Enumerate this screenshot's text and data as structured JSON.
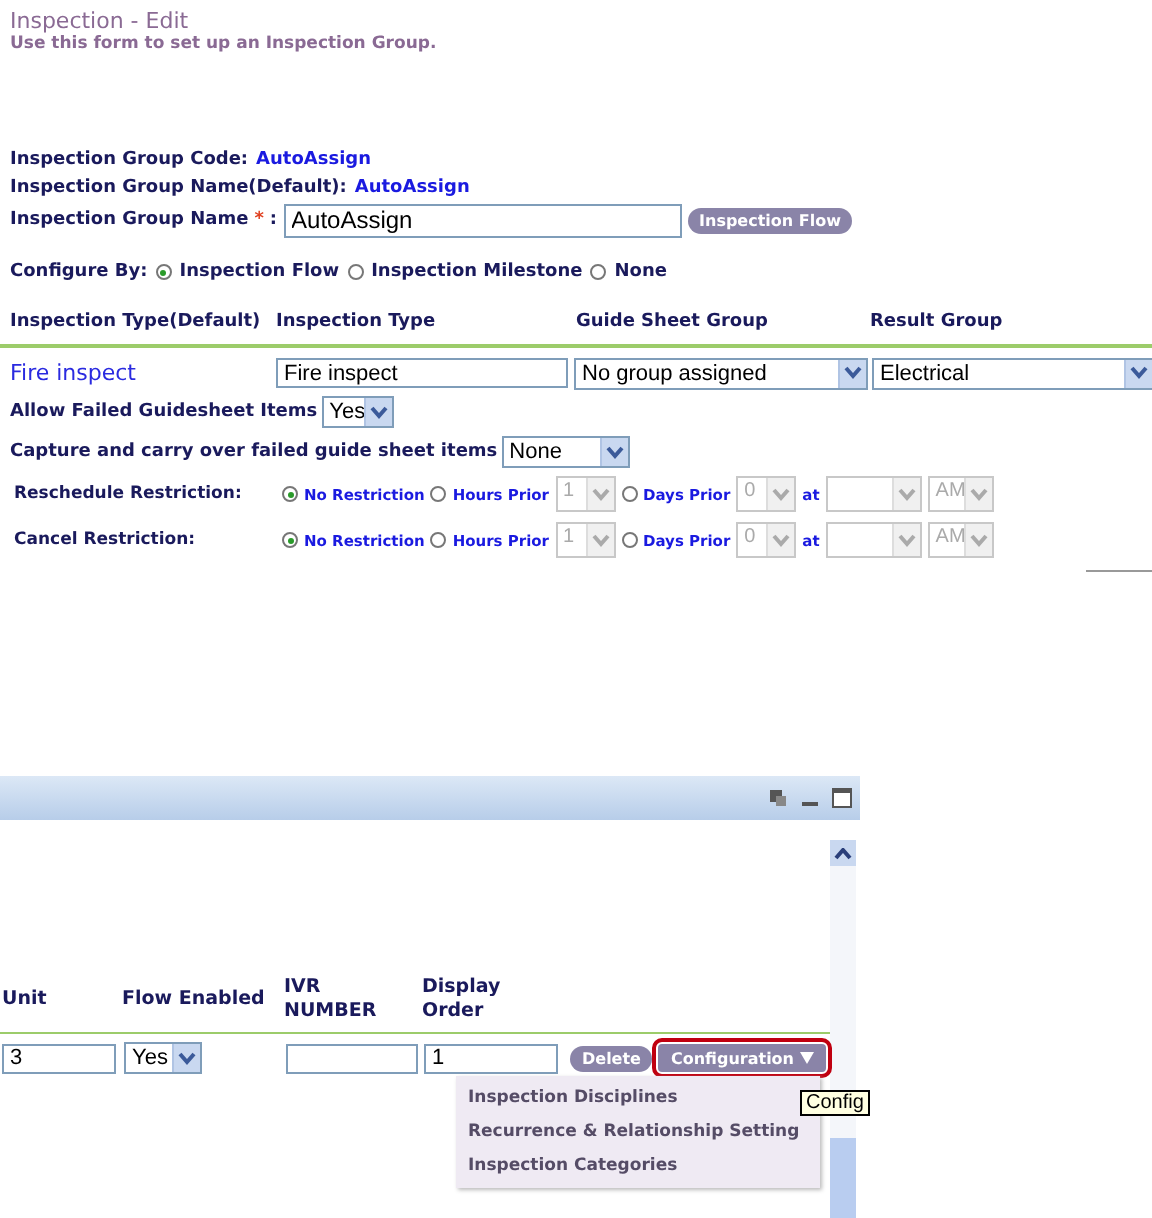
{
  "page": {
    "title": "Inspection - Edit",
    "subtitle": "Use this form to set up an Inspection Group."
  },
  "fields": [
    {
      "label": "Inspection Group Code:",
      "value": "AutoAssign"
    },
    {
      "label": "Inspection Group Name(Default):",
      "value": "AutoAssign"
    }
  ],
  "group_name": {
    "label": "Inspection Group Name",
    "required_mark": "*",
    "colon": ":",
    "value": "AutoAssign",
    "button": "Inspection Flow"
  },
  "configure_by": {
    "label": "Configure By:",
    "options": [
      {
        "label": "Inspection Flow",
        "selected": true
      },
      {
        "label": "Inspection Milestone",
        "selected": false
      },
      {
        "label": "None",
        "selected": false
      }
    ]
  },
  "type_table": {
    "columns": [
      "Inspection Type(Default)",
      "Inspection Type",
      "Guide Sheet Group",
      "Result Group"
    ],
    "row": {
      "default_type": "Fire inspect",
      "inspection_type": "Fire inspect",
      "guide_sheet_group": "No group assigned",
      "result_group": "Electrical"
    }
  },
  "allow_failed": {
    "label": "Allow Failed Guidesheet Items",
    "value": "Yes"
  },
  "capture": {
    "label": "Capture and carry over failed guide sheet items",
    "value": "None"
  },
  "restrictions": [
    {
      "label": "Reschedule Restriction:",
      "options": [
        {
          "label": "No Restriction",
          "selected": true
        },
        {
          "label": "Hours Prior",
          "selected": false
        },
        {
          "label": "Days Prior",
          "selected": false
        }
      ],
      "hours": "1",
      "days": "0",
      "at": "at",
      "ampm": "AM",
      "disabled": true
    },
    {
      "label": "Cancel Restriction:",
      "options": [
        {
          "label": "No Restriction",
          "selected": true
        },
        {
          "label": "Hours Prior",
          "selected": false
        },
        {
          "label": "Days Prior",
          "selected": false
        }
      ],
      "hours": "1",
      "days": "0",
      "at": "at",
      "ampm": "AM",
      "disabled": true
    }
  ],
  "panel": {
    "columns": [
      "Unit",
      "Flow Enabled",
      "IVR NUMBER",
      "Display Order"
    ],
    "row": {
      "unit": "3",
      "flow_enabled": "Yes",
      "display_order": "1"
    },
    "delete_button": "Delete",
    "config_button": "Configuration",
    "menu": [
      "Inspection Disciplines",
      "Recurrence & Relationship Setting",
      "Inspection Categories"
    ],
    "tooltip": "Config"
  }
}
